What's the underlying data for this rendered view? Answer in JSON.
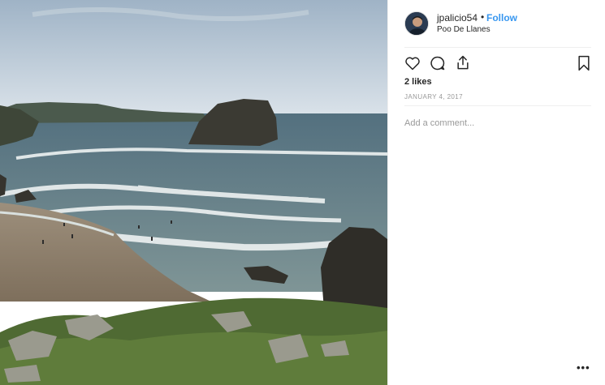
{
  "post": {
    "username": "jpalicio54",
    "separator": "•",
    "follow_label": "Follow",
    "location": "Poo De Llanes",
    "likes": "2 likes",
    "date": "JANUARY 4, 2017",
    "comment_placeholder": "Add a comment...",
    "more_label": "•••"
  },
  "icons": {
    "like": "heart-icon",
    "comment": "comment-icon",
    "share": "share-icon",
    "save": "bookmark-icon",
    "more": "more-options-icon"
  },
  "colors": {
    "follow": "#3897f0",
    "muted": "#999999",
    "text": "#262626",
    "divider": "#efefef"
  }
}
